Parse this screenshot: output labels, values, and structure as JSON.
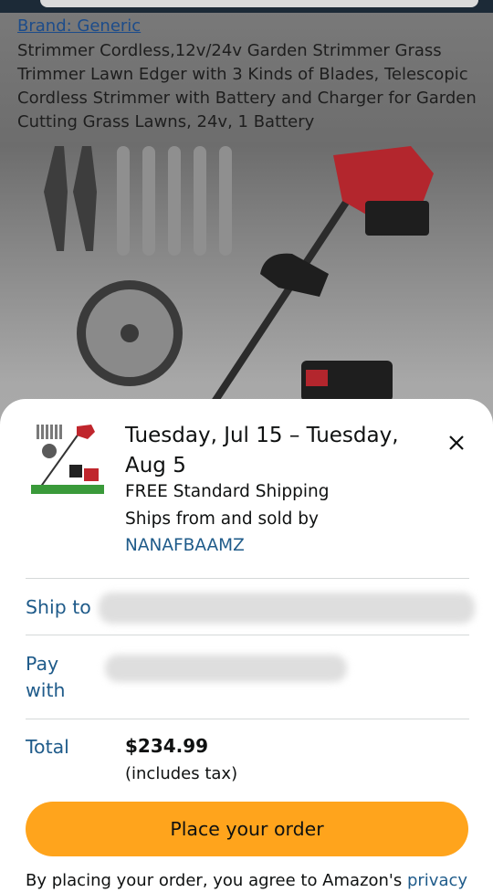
{
  "product": {
    "brand_link": "Brand: Generic",
    "title": "Strimmer Cordless,12v/24v Garden Strimmer Grass Trimmer Lawn Edger with 3 Kinds of Blades, Telescopic Cordless Strimmer with Battery and Charger for Garden Cutting Grass Lawns, 24v, 1 Battery"
  },
  "sheet": {
    "delivery_date": "Tuesday, Jul 15 – Tuesday, Aug 5",
    "shipping": "FREE Standard Shipping",
    "ships_from": "Ships from and sold by",
    "seller": "NANAFBAAMZ",
    "close_icon": "close-icon",
    "ship_to_label": "Ship to",
    "pay_with_label_line1": "Pay",
    "pay_with_label_line2": "with",
    "total_label": "Total",
    "total_value": "$234.99",
    "tax_note": "(includes tax)",
    "place_order": "Place your order",
    "legal_prefix": "By placing your order, you agree to Amazon's ",
    "legal_link": "privacy"
  },
  "colors": {
    "accent_button": "#ffa41c",
    "link": "#1f5b8a"
  }
}
